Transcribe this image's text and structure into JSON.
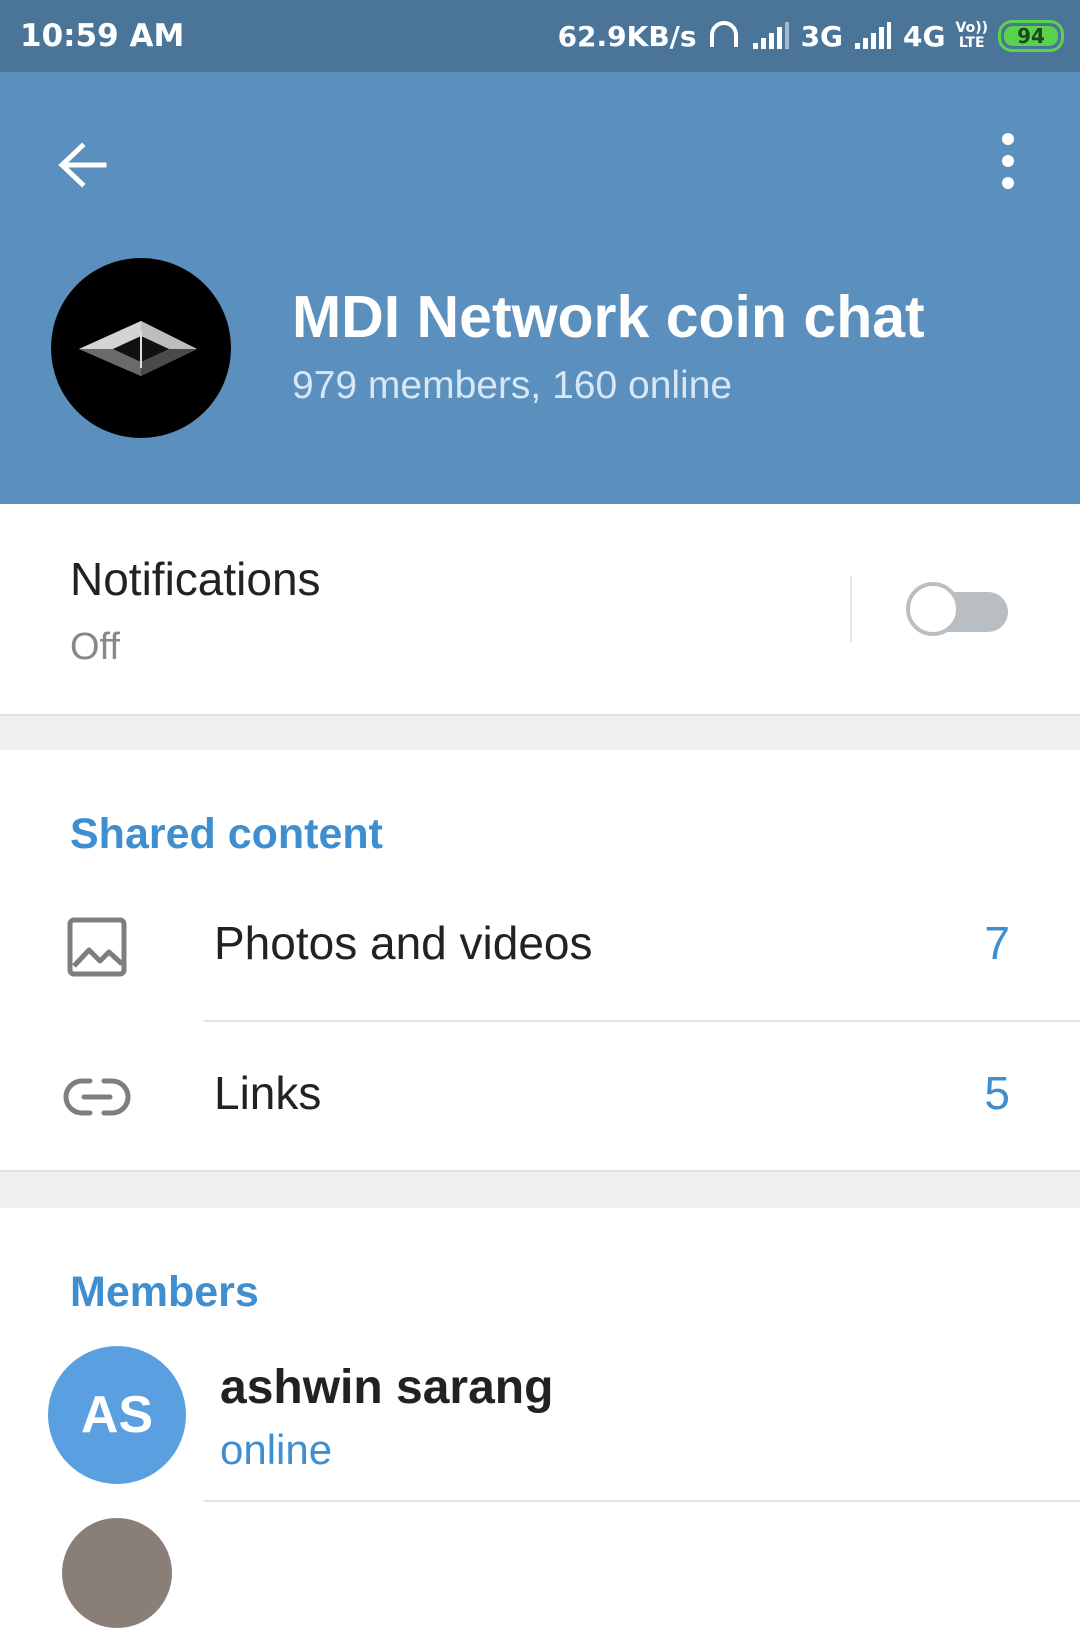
{
  "status_bar": {
    "time": "10:59 AM",
    "net_speed": "62.9KB/s",
    "sim1_type": "3G",
    "sim2_type": "4G",
    "volte_top": "Vo))",
    "volte_bottom": "LTE",
    "battery": "94",
    "battery_color": "#59d24c"
  },
  "header": {
    "background": "#5b8fbd",
    "title": "MDI Network coin chat",
    "subtitle": "979 members, 160 online"
  },
  "notifications": {
    "label": "Notifications",
    "value": "Off",
    "enabled": false
  },
  "shared_content": {
    "title": "Shared content",
    "items": [
      {
        "label": "Photos and videos",
        "count": "7",
        "icon": "image-icon"
      },
      {
        "label": "Links",
        "count": "5",
        "icon": "link-icon"
      }
    ]
  },
  "members": {
    "title": "Members",
    "list": [
      {
        "initials": "AS",
        "name": "ashwin sarang",
        "status": "online"
      }
    ]
  },
  "accent_color": "#3e8ed0"
}
